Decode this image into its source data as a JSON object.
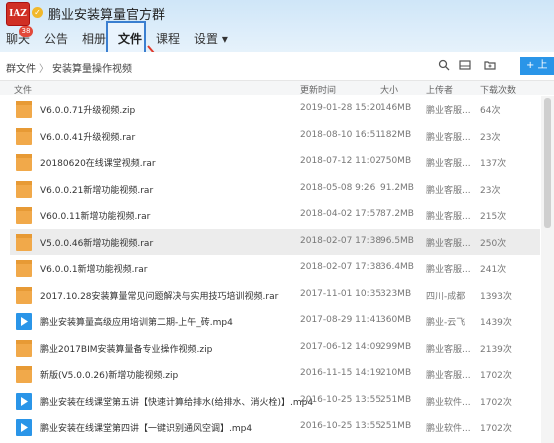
{
  "header": {
    "logo_text": "IAZ",
    "title": "鹏业安装算量官方群",
    "tabs": [
      {
        "label": "聊天",
        "badge": "38"
      },
      {
        "label": "公告"
      },
      {
        "label": "相册"
      },
      {
        "label": "文件"
      },
      {
        "label": "课程"
      },
      {
        "label": "设置 ▾"
      }
    ],
    "active_tab": "文件"
  },
  "breadcrumb": {
    "root": "群文件",
    "sep": "〉",
    "folder": "安装算量操作视频"
  },
  "upload_label": "+ 上",
  "columns": {
    "file": "文件",
    "updated": "更新时间",
    "size": "大小",
    "uploader": "上传者",
    "downloads": "下载次数"
  },
  "files": [
    {
      "name": "V6.0.0.71升级视频.zip",
      "date": "2019-01-28 15:20",
      "size": "146MB",
      "uploader": "鹏业客服...",
      "downloads": "64次",
      "type": "folder"
    },
    {
      "name": "V6.0.0.41升级视频.rar",
      "date": "2018-08-10 16:51",
      "size": "182MB",
      "uploader": "鹏业客服...",
      "downloads": "23次",
      "type": "folder"
    },
    {
      "name": "20180620在线课堂视频.rar",
      "date": "2018-07-12 11:02",
      "size": "750MB",
      "uploader": "鹏业客服...",
      "downloads": "137次",
      "type": "folder"
    },
    {
      "name": "V6.0.0.21新增功能视频.rar",
      "date": "2018-05-08 9:26",
      "size": "91.2MB",
      "uploader": "鹏业客服...",
      "downloads": "23次",
      "type": "folder"
    },
    {
      "name": "V60.0.11新增功能视频.rar",
      "date": "2018-04-02 17:57",
      "size": "87.2MB",
      "uploader": "鹏业客服...",
      "downloads": "215次",
      "type": "folder"
    },
    {
      "name": "V5.0.0.46新增功能视频.rar",
      "date": "2018-02-07 17:38",
      "size": "96.5MB",
      "uploader": "鹏业客服...",
      "downloads": "250次",
      "type": "folder",
      "selected": true
    },
    {
      "name": "V6.0.0.1新增功能视频.rar",
      "date": "2018-02-07 17:38",
      "size": "36.4MB",
      "uploader": "鹏业客服...",
      "downloads": "241次",
      "type": "folder"
    },
    {
      "name": "2017.10.28安装算量常见问题解决与实用技巧培训视频.rar",
      "date": "2017-11-01 10:35",
      "size": "323MB",
      "uploader": "四川-成都",
      "downloads": "1393次",
      "type": "folder"
    },
    {
      "name": "鹏业安装算量高级应用培训第二期-上午_砖.mp4",
      "date": "2017-08-29 11:41",
      "size": "360MB",
      "uploader": "鹏业-云飞",
      "downloads": "1439次",
      "type": "video"
    },
    {
      "name": "鹏业2017BIM安装算量备专业操作视频.zip",
      "date": "2017-06-12 14:09",
      "size": "299MB",
      "uploader": "鹏业客服...",
      "downloads": "2139次",
      "type": "folder"
    },
    {
      "name": "新版(V5.0.0.26)新增功能视频.zip",
      "date": "2016-11-15 14:19",
      "size": "210MB",
      "uploader": "鹏业客服...",
      "downloads": "1702次",
      "type": "folder"
    },
    {
      "name": "鹏业安装在线课堂第五讲【快速计算给排水(给排水、消火栓)】.mp4",
      "date": "2016-10-25 13:55",
      "size": "251MB",
      "uploader": "鹏业软件...",
      "downloads": "1702次",
      "type": "video"
    },
    {
      "name": "鹏业安装在线课堂第四讲【一键识别通风空调】.mp4",
      "date": "2016-10-25 13:55",
      "size": "251MB",
      "uploader": "鹏业软件...",
      "downloads": "1702次",
      "type": "video"
    }
  ],
  "colors": {
    "folder": "#f1a94a",
    "video": "#2a95e8",
    "accent": "#3b7fd0"
  }
}
